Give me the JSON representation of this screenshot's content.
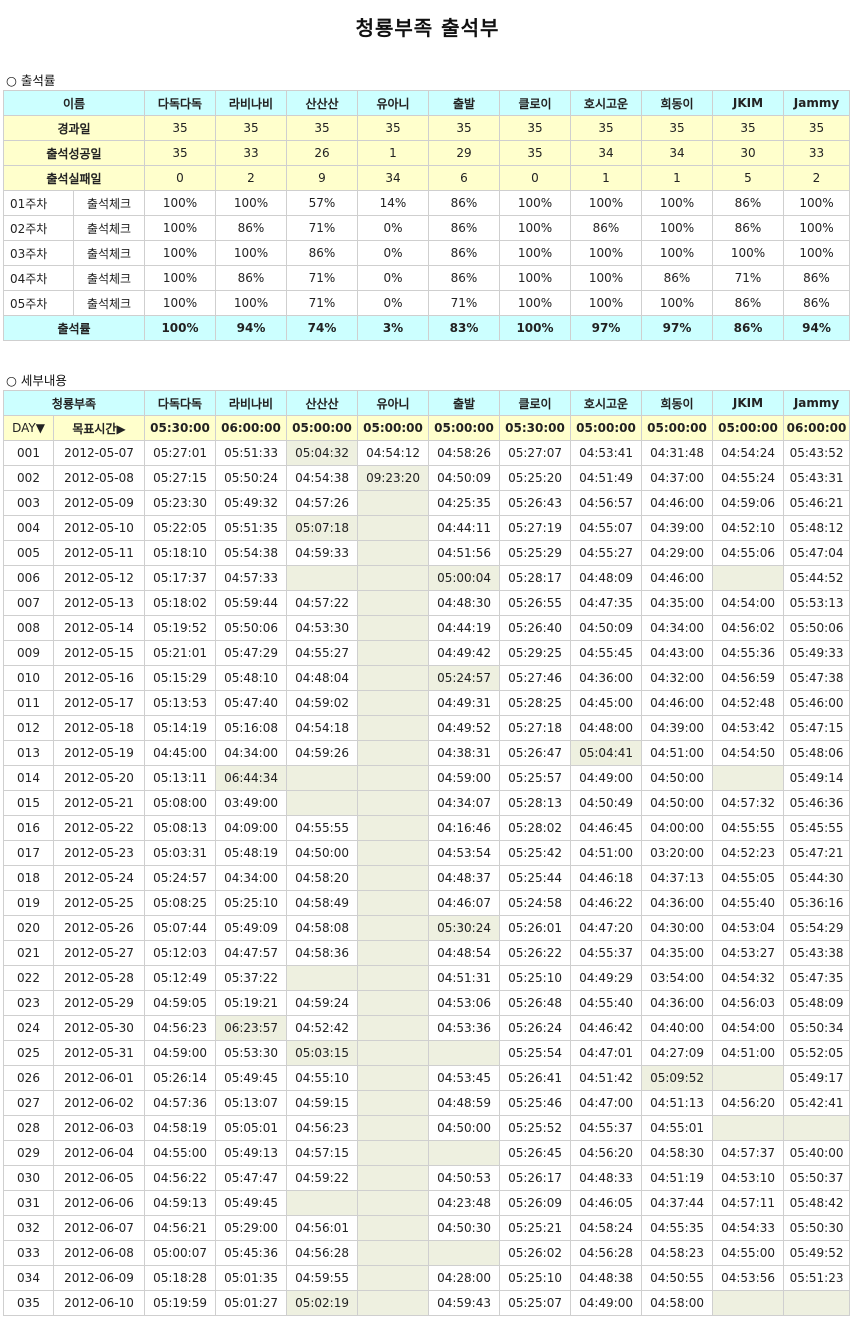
{
  "page_title": "청룡부족 출석부",
  "attendance": {
    "section_label": "○ 출석률",
    "name_header": "이름",
    "names": [
      "다독다독",
      "라비나비",
      "산산산",
      "유아니",
      "출발",
      "클로이",
      "호시고운",
      "희동이",
      "JKIM",
      "Jammy"
    ],
    "summary_rows": [
      {
        "label": "경과일",
        "values": [
          "35",
          "35",
          "35",
          "35",
          "35",
          "35",
          "35",
          "35",
          "35",
          "35"
        ]
      },
      {
        "label": "출석성공일",
        "values": [
          "35",
          "33",
          "26",
          "1",
          "29",
          "35",
          "34",
          "34",
          "30",
          "33"
        ]
      },
      {
        "label": "출석실패일",
        "values": [
          "0",
          "2",
          "9",
          "34",
          "6",
          "0",
          "1",
          "1",
          "5",
          "2"
        ]
      }
    ],
    "week_rows": [
      {
        "week": "01주차",
        "label": "출석체크",
        "values": [
          "100%",
          "100%",
          "57%",
          "14%",
          "86%",
          "100%",
          "100%",
          "100%",
          "86%",
          "100%"
        ]
      },
      {
        "week": "02주차",
        "label": "출석체크",
        "values": [
          "100%",
          "86%",
          "71%",
          "0%",
          "86%",
          "100%",
          "86%",
          "100%",
          "86%",
          "100%"
        ]
      },
      {
        "week": "03주차",
        "label": "출석체크",
        "values": [
          "100%",
          "100%",
          "86%",
          "0%",
          "86%",
          "100%",
          "100%",
          "100%",
          "100%",
          "100%"
        ]
      },
      {
        "week": "04주차",
        "label": "출석체크",
        "values": [
          "100%",
          "86%",
          "71%",
          "0%",
          "86%",
          "100%",
          "100%",
          "86%",
          "71%",
          "86%"
        ]
      },
      {
        "week": "05주차",
        "label": "출석체크",
        "values": [
          "100%",
          "100%",
          "71%",
          "0%",
          "71%",
          "100%",
          "100%",
          "100%",
          "86%",
          "86%"
        ]
      }
    ],
    "total_row": {
      "label": "출석률",
      "values": [
        "100%",
        "94%",
        "74%",
        "3%",
        "83%",
        "100%",
        "97%",
        "97%",
        "86%",
        "94%"
      ]
    }
  },
  "details": {
    "section_label": "○ 세부내용",
    "group_header": "청룡부족",
    "day_label": "DAY▼",
    "target_label": "목표시간▶",
    "targets": [
      "05:30:00",
      "06:00:00",
      "05:00:00",
      "05:00:00",
      "05:00:00",
      "05:30:00",
      "05:00:00",
      "05:00:00",
      "05:00:00",
      "06:00:00"
    ],
    "rows": [
      {
        "day": "001",
        "date": "2012-05-07",
        "times": [
          "05:27:01",
          "05:51:33",
          "05:04:32",
          "04:54:12",
          "04:58:26",
          "05:27:07",
          "04:53:41",
          "04:31:48",
          "04:54:24",
          "05:43:52"
        ]
      },
      {
        "day": "002",
        "date": "2012-05-08",
        "times": [
          "05:27:15",
          "05:50:24",
          "04:54:38",
          "09:23:20",
          "04:50:09",
          "05:25:20",
          "04:51:49",
          "04:37:00",
          "04:55:24",
          "05:43:31"
        ]
      },
      {
        "day": "003",
        "date": "2012-05-09",
        "times": [
          "05:23:30",
          "05:49:32",
          "04:57:26",
          "",
          "04:25:35",
          "05:26:43",
          "04:56:57",
          "04:46:00",
          "04:59:06",
          "05:46:21"
        ]
      },
      {
        "day": "004",
        "date": "2012-05-10",
        "times": [
          "05:22:05",
          "05:51:35",
          "05:07:18",
          "",
          "04:44:11",
          "05:27:19",
          "04:55:07",
          "04:39:00",
          "04:52:10",
          "05:48:12"
        ]
      },
      {
        "day": "005",
        "date": "2012-05-11",
        "times": [
          "05:18:10",
          "05:54:38",
          "04:59:33",
          "",
          "04:51:56",
          "05:25:29",
          "04:55:27",
          "04:29:00",
          "04:55:06",
          "05:47:04"
        ]
      },
      {
        "day": "006",
        "date": "2012-05-12",
        "times": [
          "05:17:37",
          "04:57:33",
          "",
          "",
          "05:00:04",
          "05:28:17",
          "04:48:09",
          "04:46:00",
          "",
          "05:44:52"
        ]
      },
      {
        "day": "007",
        "date": "2012-05-13",
        "times": [
          "05:18:02",
          "05:59:44",
          "04:57:22",
          "",
          "04:48:30",
          "05:26:55",
          "04:47:35",
          "04:35:00",
          "04:54:00",
          "05:53:13"
        ]
      },
      {
        "day": "008",
        "date": "2012-05-14",
        "times": [
          "05:19:52",
          "05:50:06",
          "04:53:30",
          "",
          "04:44:19",
          "05:26:40",
          "04:50:09",
          "04:34:00",
          "04:56:02",
          "05:50:06"
        ]
      },
      {
        "day": "009",
        "date": "2012-05-15",
        "times": [
          "05:21:01",
          "05:47:29",
          "04:55:27",
          "",
          "04:49:42",
          "05:29:25",
          "04:55:45",
          "04:43:00",
          "04:55:36",
          "05:49:33"
        ]
      },
      {
        "day": "010",
        "date": "2012-05-16",
        "times": [
          "05:15:29",
          "05:48:10",
          "04:48:04",
          "",
          "05:24:57",
          "05:27:46",
          "04:36:00",
          "04:32:00",
          "04:56:59",
          "05:47:38"
        ]
      },
      {
        "day": "011",
        "date": "2012-05-17",
        "times": [
          "05:13:53",
          "05:47:40",
          "04:59:02",
          "",
          "04:49:31",
          "05:28:25",
          "04:45:00",
          "04:46:00",
          "04:52:48",
          "05:46:00"
        ]
      },
      {
        "day": "012",
        "date": "2012-05-18",
        "times": [
          "05:14:19",
          "05:16:08",
          "04:54:18",
          "",
          "04:49:52",
          "05:27:18",
          "04:48:00",
          "04:39:00",
          "04:53:42",
          "05:47:15"
        ]
      },
      {
        "day": "013",
        "date": "2012-05-19",
        "times": [
          "04:45:00",
          "04:34:00",
          "04:59:26",
          "",
          "04:38:31",
          "05:26:47",
          "05:04:41",
          "04:51:00",
          "04:54:50",
          "05:48:06"
        ]
      },
      {
        "day": "014",
        "date": "2012-05-20",
        "times": [
          "05:13:11",
          "06:44:34",
          "",
          "",
          "04:59:00",
          "05:25:57",
          "04:49:00",
          "04:50:00",
          "",
          "05:49:14"
        ]
      },
      {
        "day": "015",
        "date": "2012-05-21",
        "times": [
          "05:08:00",
          "03:49:00",
          "",
          "",
          "04:34:07",
          "05:28:13",
          "04:50:49",
          "04:50:00",
          "04:57:32",
          "05:46:36"
        ]
      },
      {
        "day": "016",
        "date": "2012-05-22",
        "times": [
          "05:08:13",
          "04:09:00",
          "04:55:55",
          "",
          "04:16:46",
          "05:28:02",
          "04:46:45",
          "04:00:00",
          "04:55:55",
          "05:45:55"
        ]
      },
      {
        "day": "017",
        "date": "2012-05-23",
        "times": [
          "05:03:31",
          "05:48:19",
          "04:50:00",
          "",
          "04:53:54",
          "05:25:42",
          "04:51:00",
          "03:20:00",
          "04:52:23",
          "05:47:21"
        ]
      },
      {
        "day": "018",
        "date": "2012-05-24",
        "times": [
          "05:24:57",
          "04:34:00",
          "04:58:20",
          "",
          "04:48:37",
          "05:25:44",
          "04:46:18",
          "04:37:13",
          "04:55:05",
          "05:44:30"
        ]
      },
      {
        "day": "019",
        "date": "2012-05-25",
        "times": [
          "05:08:25",
          "05:25:10",
          "04:58:49",
          "",
          "04:46:07",
          "05:24:58",
          "04:46:22",
          "04:36:00",
          "04:55:40",
          "05:36:16"
        ]
      },
      {
        "day": "020",
        "date": "2012-05-26",
        "times": [
          "05:07:44",
          "05:49:09",
          "04:58:08",
          "",
          "05:30:24",
          "05:26:01",
          "04:47:20",
          "04:30:00",
          "04:53:04",
          "05:54:29"
        ]
      },
      {
        "day": "021",
        "date": "2012-05-27",
        "times": [
          "05:12:03",
          "04:47:57",
          "04:58:36",
          "",
          "04:48:54",
          "05:26:22",
          "04:55:37",
          "04:35:00",
          "04:53:27",
          "05:43:38"
        ]
      },
      {
        "day": "022",
        "date": "2012-05-28",
        "times": [
          "05:12:49",
          "05:37:22",
          "",
          "",
          "04:51:31",
          "05:25:10",
          "04:49:29",
          "03:54:00",
          "04:54:32",
          "05:47:35"
        ]
      },
      {
        "day": "023",
        "date": "2012-05-29",
        "times": [
          "04:59:05",
          "05:19:21",
          "04:59:24",
          "",
          "04:53:06",
          "05:26:48",
          "04:55:40",
          "04:36:00",
          "04:56:03",
          "05:48:09"
        ]
      },
      {
        "day": "024",
        "date": "2012-05-30",
        "times": [
          "04:56:23",
          "06:23:57",
          "04:52:42",
          "",
          "04:53:36",
          "05:26:24",
          "04:46:42",
          "04:40:00",
          "04:54:00",
          "05:50:34"
        ]
      },
      {
        "day": "025",
        "date": "2012-05-31",
        "times": [
          "04:59:00",
          "05:53:30",
          "05:03:15",
          "",
          "",
          "05:25:54",
          "04:47:01",
          "04:27:09",
          "04:51:00",
          "05:52:05"
        ]
      },
      {
        "day": "026",
        "date": "2012-06-01",
        "times": [
          "05:26:14",
          "05:49:45",
          "04:55:10",
          "",
          "04:53:45",
          "05:26:41",
          "04:51:42",
          "05:09:52",
          "",
          "05:49:17"
        ]
      },
      {
        "day": "027",
        "date": "2012-06-02",
        "times": [
          "04:57:36",
          "05:13:07",
          "04:59:15",
          "",
          "04:48:59",
          "05:25:46",
          "04:47:00",
          "04:51:13",
          "04:56:20",
          "05:42:41"
        ]
      },
      {
        "day": "028",
        "date": "2012-06-03",
        "times": [
          "04:58:19",
          "05:05:01",
          "04:56:23",
          "",
          "04:50:00",
          "05:25:52",
          "04:55:37",
          "04:55:01",
          "",
          ""
        ]
      },
      {
        "day": "029",
        "date": "2012-06-04",
        "times": [
          "04:55:00",
          "05:49:13",
          "04:57:15",
          "",
          "",
          "05:26:45",
          "04:56:20",
          "04:58:30",
          "04:57:37",
          "05:40:00"
        ]
      },
      {
        "day": "030",
        "date": "2012-06-05",
        "times": [
          "04:56:22",
          "05:47:47",
          "04:59:22",
          "",
          "04:50:53",
          "05:26:17",
          "04:48:33",
          "04:51:19",
          "04:53:10",
          "05:50:37"
        ]
      },
      {
        "day": "031",
        "date": "2012-06-06",
        "times": [
          "04:59:13",
          "05:49:45",
          "",
          "",
          "04:23:48",
          "05:26:09",
          "04:46:05",
          "04:37:44",
          "04:57:11",
          "05:48:42"
        ]
      },
      {
        "day": "032",
        "date": "2012-06-07",
        "times": [
          "04:56:21",
          "05:29:00",
          "04:56:01",
          "",
          "04:50:30",
          "05:25:21",
          "04:58:24",
          "04:55:35",
          "04:54:33",
          "05:50:30"
        ]
      },
      {
        "day": "033",
        "date": "2012-06-08",
        "times": [
          "05:00:07",
          "05:45:36",
          "04:56:28",
          "",
          "",
          "05:26:02",
          "04:56:28",
          "04:58:23",
          "04:55:00",
          "05:49:52"
        ]
      },
      {
        "day": "034",
        "date": "2012-06-09",
        "times": [
          "05:18:28",
          "05:01:35",
          "04:59:55",
          "",
          "04:28:00",
          "05:25:10",
          "04:48:38",
          "04:50:55",
          "04:53:56",
          "05:51:23"
        ]
      },
      {
        "day": "035",
        "date": "2012-06-10",
        "times": [
          "05:19:59",
          "05:01:27",
          "05:02:19",
          "",
          "04:59:43",
          "05:25:07",
          "04:49:00",
          "04:58:00",
          "",
          ""
        ]
      }
    ]
  },
  "colors": {
    "header_cyan": "#ccffff",
    "header_yellow": "#ffffcc",
    "late_or_missing": "#eef0e0",
    "border": "#cfcfcf"
  }
}
